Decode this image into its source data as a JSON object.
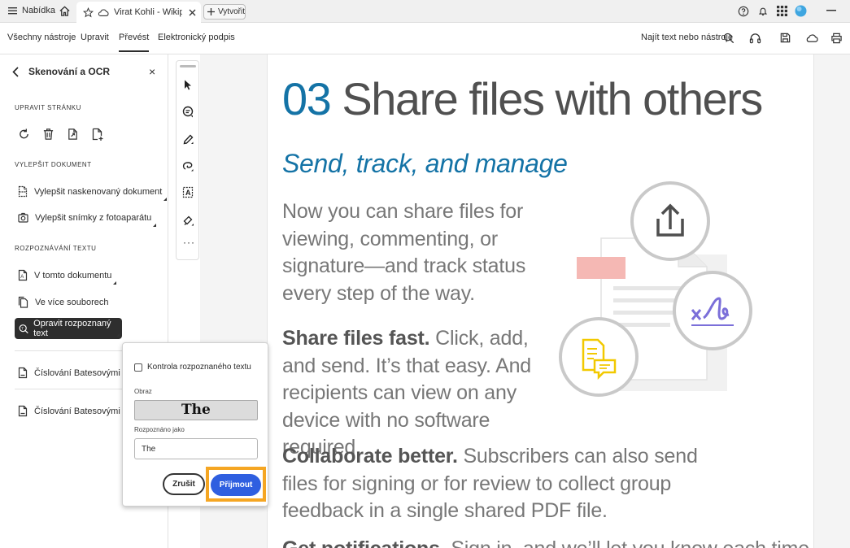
{
  "browser": {
    "menu_label": "Nabídka",
    "tab_title": "Virat Kohli - Wikipe",
    "new_tab_label": "Vytvořit"
  },
  "toolbar": {
    "tabs": [
      "Všechny nástroje",
      "Upravit",
      "Převést",
      "Elektronický podpis"
    ],
    "active_tab": "Převést",
    "find_label": "Najít text nebo nástroje"
  },
  "panel": {
    "title": "Skenování a OCR",
    "section_edit": "UPRAVIT STRÁNKU",
    "section_enhance": "VYLEPŠIT DOKUMENT",
    "enhance_items": [
      "Vylepšit naskenovaný dokument",
      "Vylepšit snímky z fotoaparátu"
    ],
    "section_recognize": "ROZPOZNÁVÁNÍ TEXTU",
    "recognize_items": [
      "V tomto dokumentu",
      "Ve více souborech"
    ],
    "selected_item": "Opravit rozpoznaný text",
    "bates_items": [
      "Číslování Batesovými čísly",
      "Číslování Batesovými čísly"
    ]
  },
  "document": {
    "heading_number": "03",
    "heading_text": "Share files with others",
    "subheading": "Send, track, and manage",
    "intro": "Now you can share files for viewing, commenting, or signature—and track status every step of the way.",
    "p1_bold": "Share files fast.",
    "p1_text": " Click, add, and send. It’s that easy. And recipients can view on any device with no software required.",
    "p2_bold": "Collaborate better.",
    "p2_text": " Subscribers can also send files for signing or for review to collect group feedback in a single shared PDF file.",
    "p3_bold": "Get notifications.",
    "p3_text": " Sign in, and we’ll let you know each time"
  },
  "popup": {
    "checkbox_label": "Kontrola rozpoznaného textu",
    "checkbox_checked": false,
    "image_label": "Obraz",
    "image_text": "The",
    "recognized_label": "Rozpoznáno jako",
    "recognized_value": "The",
    "cancel_label": "Zrušit",
    "accept_label": "Přijmout"
  },
  "colors": {
    "accent_blue": "#1473a6",
    "accept_button": "#2f5fe0",
    "highlight": "#f5a623"
  }
}
